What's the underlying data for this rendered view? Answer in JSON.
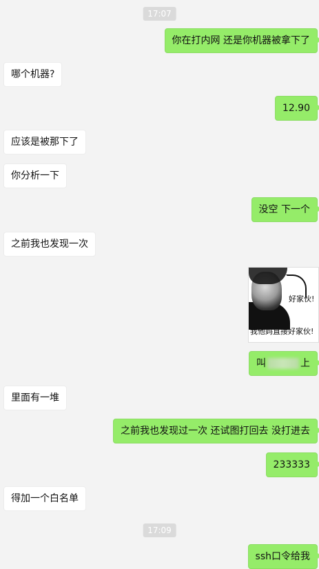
{
  "timestamps": [
    "17:07",
    "17:09"
  ],
  "messages": {
    "m1": "你在打内网 还是你机器被拿下了",
    "m2": "哪个机器?",
    "m3": "12.90",
    "m4": "应该是被那下了",
    "m5": "你分析一下",
    "m6": "没空  下一个",
    "m7": "之前我也发现一次",
    "m9_prefix": "叫",
    "m9_suffix": "上",
    "m10": "里面有一堆",
    "m11": "之前我也发现过一次 还试图打回去  没打进去",
    "m12": "233333",
    "m13": "得加一个白名单",
    "m14": "ssh口令给我"
  },
  "sticker": {
    "top_text": "好家伙!",
    "bottom_text": "我他妈直接好家伙!",
    "icon": "meme-face-sticker"
  },
  "colors": {
    "background": "#f3f3f3",
    "sent_bubble": "#95ec69",
    "received_bubble": "#ffffff",
    "timestamp_bg": "#dadada"
  }
}
